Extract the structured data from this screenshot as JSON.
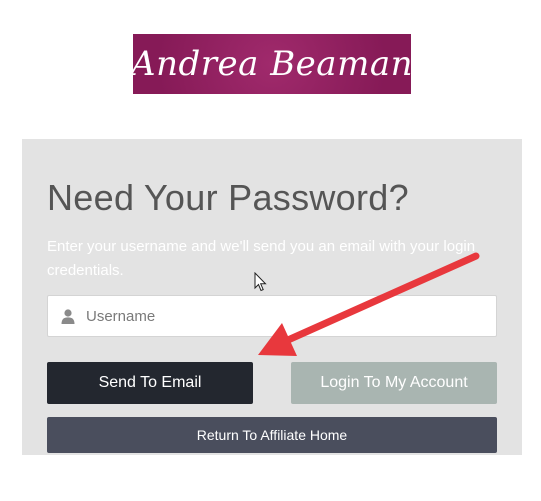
{
  "logo": {
    "text": "Andrea Beaman",
    "background": "#8c1f5e"
  },
  "form": {
    "title": "Need Your Password?",
    "description": "Enter your username and we'll send you an email with your login credentials.",
    "username": {
      "placeholder": "Username",
      "value": "",
      "icon": "user-icon"
    },
    "buttons": {
      "send": "Send To Email",
      "login": "Login To My Account",
      "return": "Return To Affiliate Home"
    }
  },
  "annotation": {
    "arrow_color": "#e8383d",
    "arrow_icon": "red-arrow-annotation"
  },
  "colors": {
    "panel": "#e3e3e3",
    "send_button": "#23272f",
    "login_button": "#a9b5b1",
    "return_button": "#4a4e5d"
  }
}
